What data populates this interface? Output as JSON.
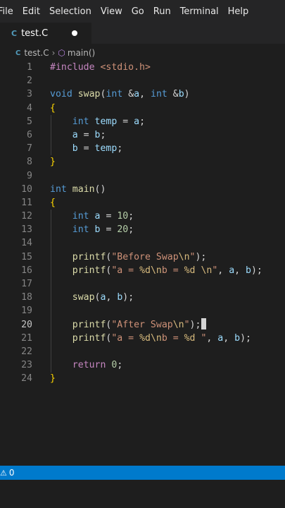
{
  "menu": [
    "File",
    "Edit",
    "Selection",
    "View",
    "Go",
    "Run",
    "Terminal",
    "Help"
  ],
  "tab": {
    "icon": "c-file-icon",
    "icon_text": "C",
    "label": "test.C",
    "modified": true
  },
  "breadcrumb": {
    "file": "test.C",
    "symbol": "main()"
  },
  "editor": {
    "active_line": 20,
    "lines": [
      "#include <stdio.h>",
      "",
      "void swap(int &a, int &b)",
      "{",
      "    int temp = a;",
      "    a = b;",
      "    b = temp;",
      "}",
      "",
      "int main()",
      "{",
      "    int a = 10;",
      "    int b = 20;",
      "",
      "    printf(\"Before Swap\\n\");",
      "    printf(\"a = %d\\nb = %d \\n\", a, b);",
      "",
      "    swap(a, b);",
      "",
      "    printf(\"After Swap\\n\");",
      "    printf(\"a = %d\\nb = %d \", a, b);",
      "",
      "    return 0;",
      "}"
    ]
  },
  "status": {
    "warning_icon": "warning-icon",
    "problems_count": "0"
  },
  "colors": {
    "editor_bg": "#1e1e1e",
    "status_bar": "#007acc",
    "keyword": "#569cd6",
    "function": "#dcdcaa",
    "string": "#ce9178",
    "number": "#b5cea8"
  }
}
